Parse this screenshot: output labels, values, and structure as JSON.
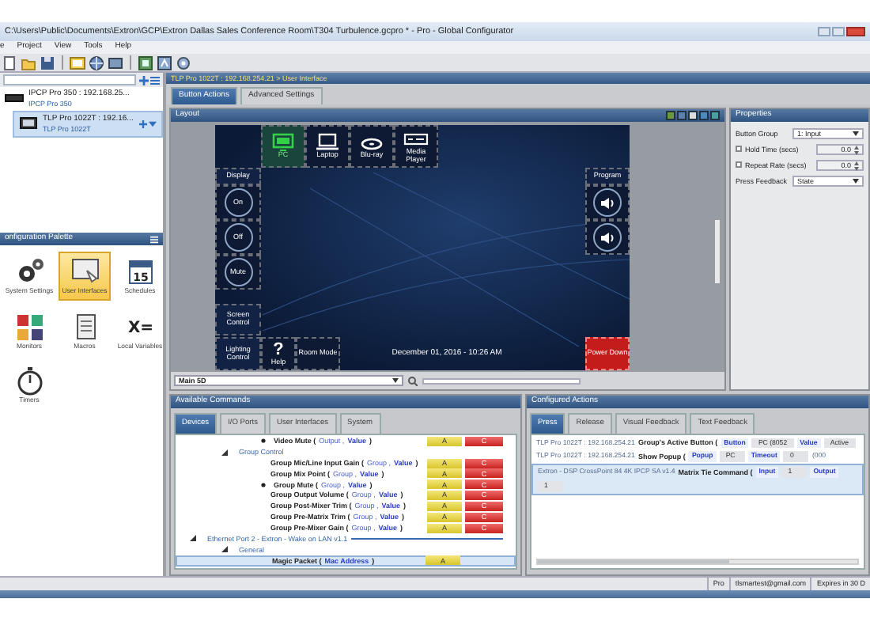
{
  "window": {
    "title": "C:\\Users\\Public\\Documents\\Extron\\GCP\\Extron Dallas Sales Conference Room\\T304 Turbulence.gcpro * - Pro - Global Configurator"
  },
  "menu": [
    "e",
    "Project",
    "View",
    "Tools",
    "Help"
  ],
  "device_tree": {
    "items": [
      {
        "name": "IPCP Pro 350 : 192.168.25...",
        "model": "IPCP Pro 350",
        "selected": false
      },
      {
        "name": "TLP Pro 1022T : 192.16...",
        "model": "TLP Pro 1022T",
        "selected": true
      }
    ]
  },
  "palette": {
    "title": "onfiguration Palette",
    "items": [
      {
        "label": "System Settings",
        "selected": false
      },
      {
        "label": "User Interfaces",
        "selected": true
      },
      {
        "label": "Schedules",
        "selected": false,
        "icon_text": "15"
      },
      {
        "label": "Monitors",
        "selected": false
      },
      {
        "label": "Macros",
        "selected": false
      },
      {
        "label": "Local Variables",
        "selected": false,
        "icon_text": "X="
      },
      {
        "label": "Timers",
        "selected": false
      }
    ]
  },
  "breadcrumb": "TLP Pro 1022T : 192.168.254.21 > User Interface",
  "editor_tabs": [
    {
      "label": "Button Actions",
      "selected": true
    },
    {
      "label": "Advanced Settings",
      "selected": false
    }
  ],
  "layout": {
    "title": "Layout",
    "sources": [
      {
        "label": "PC",
        "selected": true
      },
      {
        "label": "Laptop",
        "selected": false
      },
      {
        "label": "Blu-ray",
        "selected": false
      },
      {
        "label": "Media Player",
        "selected": false
      }
    ],
    "display_label": "Display",
    "display_buttons": [
      "On",
      "Off",
      "Mute"
    ],
    "screen_control": "Screen Control",
    "lighting_control": "Lighting Control",
    "help_glyph": "?",
    "help_label": "Help",
    "room_mode": "Room Mode",
    "clock": "December 01, 2016 - 10:26 AM",
    "power_down": "Power Down",
    "program_label": "Program",
    "page_select": "Main 5D"
  },
  "properties": {
    "title": "Properties",
    "fields": [
      {
        "kind": "select",
        "label": "Button Group",
        "value": "1: Input"
      },
      {
        "kind": "spin",
        "label": "Hold Time (secs)",
        "checked": false,
        "value": "0.0"
      },
      {
        "kind": "spin",
        "label": "Repeat Rate (secs)",
        "checked": false,
        "value": "0.0"
      },
      {
        "kind": "select",
        "label": "Press Feedback",
        "value": "State"
      }
    ]
  },
  "available_commands": {
    "title": "Available Commands",
    "tabs": [
      {
        "label": "Devices",
        "selected": true
      },
      {
        "label": "I/O Ports",
        "selected": false
      },
      {
        "label": "User Interfaces",
        "selected": false
      },
      {
        "label": "System",
        "selected": false
      }
    ],
    "tree": [
      {
        "kind": "command",
        "name": "Video Mute (",
        "params": [
          "Output ,",
          "Value"
        ],
        "close": ")",
        "buttons": [
          "A",
          "C"
        ],
        "marked": true,
        "selected": false
      },
      {
        "kind": "group",
        "name": "Group Control",
        "expanded": true,
        "children": [
          {
            "kind": "command",
            "name": "Group Mic/Line Input Gain (",
            "params": [
              "Group ,",
              "Value"
            ],
            "close": ")",
            "buttons": [
              "A",
              "C"
            ],
            "marked": false,
            "selected": false
          },
          {
            "kind": "command",
            "name": "Group Mix Point (",
            "params": [
              "Group ,",
              "Value"
            ],
            "close": ")",
            "buttons": [
              "A",
              "C"
            ],
            "marked": false,
            "selected": false
          },
          {
            "kind": "command",
            "name": "Group Mute (",
            "params": [
              "Group ,",
              "Value"
            ],
            "close": ")",
            "buttons": [
              "A",
              "C"
            ],
            "marked": true,
            "selected": false
          },
          {
            "kind": "command",
            "name": "Group Output Volume (",
            "params": [
              "Group ,",
              "Value"
            ],
            "close": ")",
            "buttons": [
              "A",
              "C"
            ],
            "marked": false,
            "selected": false
          },
          {
            "kind": "command",
            "name": "Group Post-Mixer Trim (",
            "params": [
              "Group ,",
              "Value"
            ],
            "close": ")",
            "buttons": [
              "A",
              "C"
            ],
            "marked": false,
            "selected": false
          },
          {
            "kind": "command",
            "name": "Group Pre-Matrix Trim (",
            "params": [
              "Group ,",
              "Value"
            ],
            "close": ")",
            "buttons": [
              "A",
              "C"
            ],
            "marked": false,
            "selected": false
          },
          {
            "kind": "command",
            "name": "Group Pre-Mixer Gain (",
            "params": [
              "Group ,",
              "Value"
            ],
            "close": ")",
            "buttons": [
              "A",
              "C"
            ],
            "marked": false,
            "selected": false
          }
        ]
      },
      {
        "kind": "device",
        "name": "Ethernet Port 2 - Extron - Wake on LAN v1.1",
        "expanded": true,
        "children": [
          {
            "kind": "group",
            "name": "General",
            "expanded": true,
            "children": [
              {
                "kind": "command",
                "name": "Magic Packet (",
                "params": [
                  "Mac Address"
                ],
                "close": ")",
                "buttons": [
                  "A"
                ],
                "marked": false,
                "selected": true
              }
            ]
          }
        ]
      }
    ]
  },
  "configured_actions": {
    "title": "Configured Actions",
    "tabs": [
      {
        "label": "Press",
        "selected": true
      },
      {
        "label": "Release",
        "selected": false
      },
      {
        "label": "Visual Feedback",
        "selected": false
      },
      {
        "label": "Text Feedback",
        "selected": false
      }
    ],
    "rows": [
      {
        "device": "TLP Pro 1022T : 192.168.254.21",
        "command": "Group's Active Button (",
        "fields": [
          {
            "label": "Button",
            "value": "PC (8052"
          },
          {
            "label": "Value",
            "value": "Active"
          }
        ],
        "selected": false
      },
      {
        "device": "TLP Pro 1022T : 192.168.254.21",
        "command": "Show Popup (",
        "fields": [
          {
            "label": "Popup",
            "value": "PC"
          },
          {
            "label": "Timeout",
            "value": "0"
          }
        ],
        "tail": "(000",
        "selected": false
      },
      {
        "device": "Extron - DSP CrossPoint 84 4K IPCP SA v1.4",
        "command": "Matrix Tie Command (",
        "fields": [
          {
            "label": "Input",
            "value": "1"
          },
          {
            "label": "Output",
            "value": "1"
          }
        ],
        "selected": true
      }
    ]
  },
  "status_bar": [
    "Pro",
    "tlsmartest@gmail.com",
    "Expires in 30 D"
  ]
}
